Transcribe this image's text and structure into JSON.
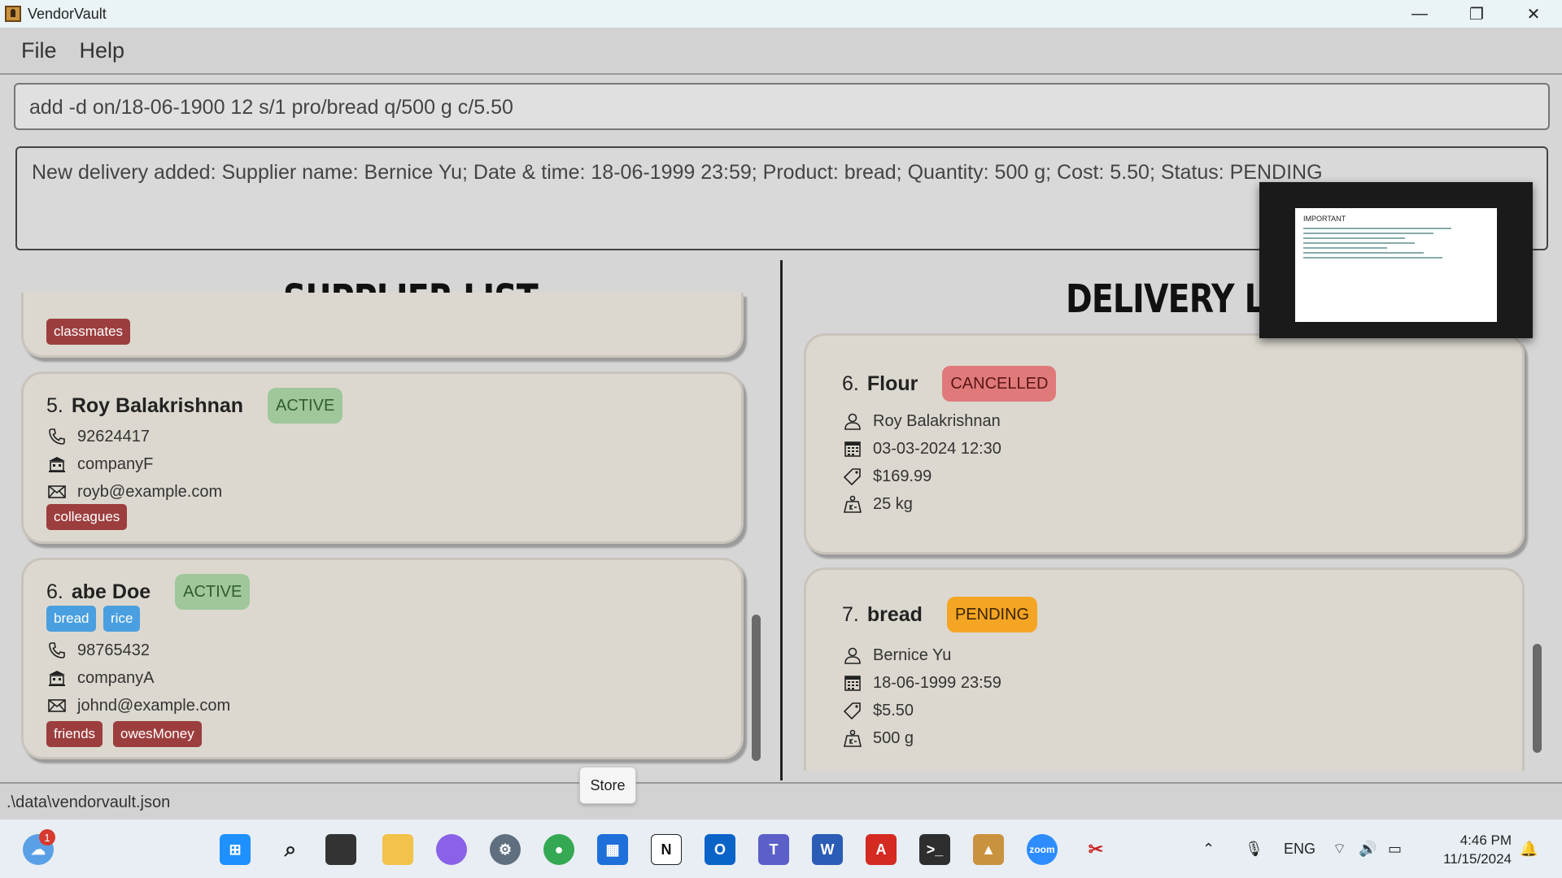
{
  "window": {
    "title": "VendorVault",
    "controls": [
      "—",
      "❐",
      "✕"
    ]
  },
  "menu": {
    "file": "File",
    "help": "Help"
  },
  "command": {
    "value": "add -d on/18-06-1900 12 s/1 pro/bread q/500 g c/5.50"
  },
  "result": {
    "text": "New delivery added: Supplier name: Bernice Yu; Date & time: 18-06-1999 23:59; Product: bread; Quantity: 500 g; Cost: 5.50; Status: PENDING"
  },
  "supplier_panel": {
    "title": "SUPPLIER LIST",
    "partial_card": {
      "tags": [
        "classmates"
      ]
    },
    "cards": [
      {
        "index": "5.",
        "name": "Roy Balakrishnan",
        "status": "ACTIVE",
        "products": [],
        "phone": "92624417",
        "company": "companyF",
        "email": "royb@example.com",
        "tags": [
          "colleagues"
        ]
      },
      {
        "index": "6.",
        "name": "abe Doe",
        "status": "ACTIVE",
        "products": [
          "bread",
          "rice"
        ],
        "phone": "98765432",
        "company": "companyA",
        "email": "johnd@example.com",
        "tags": [
          "friends",
          "owesMoney"
        ]
      }
    ]
  },
  "delivery_panel": {
    "title": "DELIVERY LIS",
    "cards": [
      {
        "index": "6.",
        "product": "Flour",
        "status": "CANCELLED",
        "supplier": "Roy Balakrishnan",
        "datetime": "03-03-2024 12:30",
        "cost": "$169.99",
        "quantity": "25 kg"
      },
      {
        "index": "7.",
        "product": "bread",
        "status": "PENDING",
        "supplier": "Bernice Yu",
        "datetime": "18-06-1999 23:59",
        "cost": "$5.50",
        "quantity": "500 g"
      }
    ]
  },
  "statusbar": {
    "path": ".\\data\\vendorvault.json"
  },
  "tooltip": {
    "text": "Store"
  },
  "thumbnail": {
    "title": "IMPORTANT"
  },
  "colors": {
    "active": "#9fc79a",
    "cancelled": "#e07a7a",
    "pending": "#f5a524",
    "tag_red": "#9c3e3e",
    "tag_blue": "#4a9fe0",
    "card_bg": "#dcd8cf"
  },
  "taskbar": {
    "notification_count": "1",
    "tray": {
      "language": "ENG"
    },
    "clock": {
      "time": "4:46 PM",
      "date": "11/15/2024"
    },
    "apps": [
      "weather-icon",
      "start-icon",
      "search-icon",
      "task-view-icon",
      "file-explorer-icon",
      "copilot-icon",
      "settings-icon",
      "chrome-icon",
      "store-icon",
      "notion-icon",
      "outlook-icon",
      "teams-icon",
      "word-icon",
      "acrobat-icon",
      "terminal-icon",
      "vendorvault-icon",
      "zoom-icon",
      "snipping-tool-icon"
    ]
  }
}
